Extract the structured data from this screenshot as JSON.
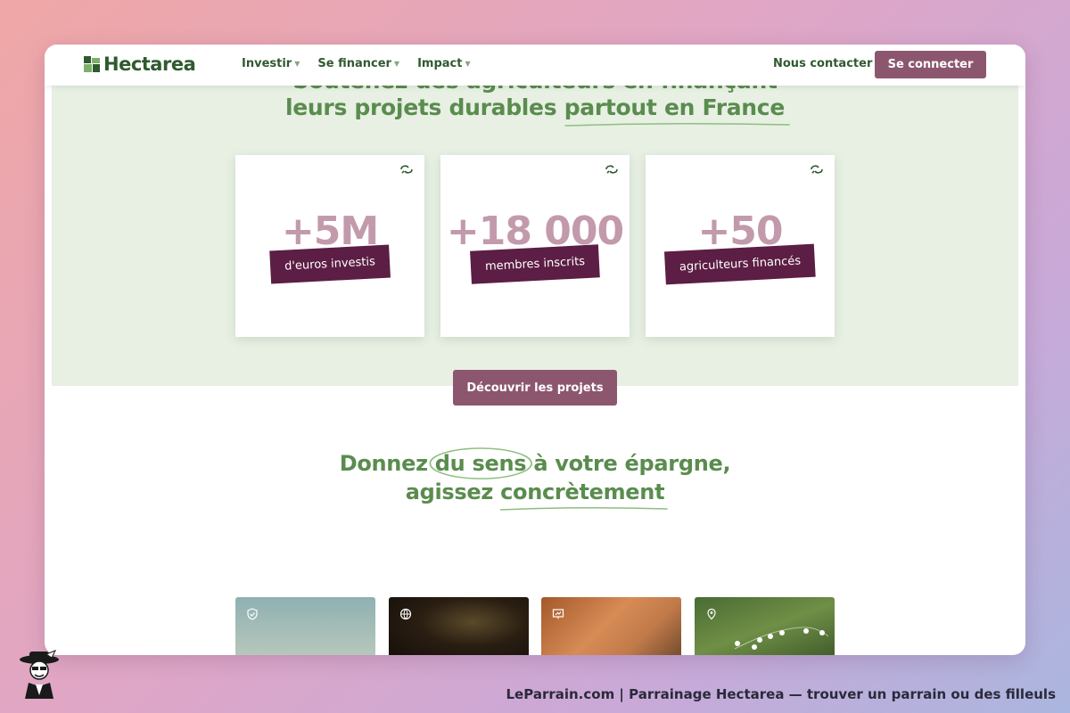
{
  "brand": {
    "name": "Hectarea"
  },
  "nav": {
    "items": [
      {
        "label": "Investir"
      },
      {
        "label": "Se financer"
      },
      {
        "label": "Impact"
      }
    ],
    "contact_label": "Nous contacter",
    "login_label": "Se connecter"
  },
  "hero": {
    "line1": "Soutenez des agriculteurs en finançant",
    "line2_prefix": "leurs projets durables ",
    "line2_highlight": "partout en France"
  },
  "stats": [
    {
      "value": "+5M",
      "label": "d'euros investis",
      "icon": "sprout-icon"
    },
    {
      "value": "+18 000",
      "label": "membres inscrits",
      "icon": "sprout-icon"
    },
    {
      "value": "+50",
      "label": "agriculteurs financés",
      "icon": "sprout-icon"
    }
  ],
  "cta": {
    "discover_label": "Découvrir les projets"
  },
  "section": {
    "line1_prefix": "Donnez ",
    "line1_circled": "du sens",
    "line1_suffix": " à votre épargne,",
    "line2_prefix": "agissez ",
    "line2_highlight": "concrètement"
  },
  "thumbnails": [
    {
      "icon": "shield-check-icon"
    },
    {
      "icon": "globe-icon"
    },
    {
      "icon": "presentation-icon"
    },
    {
      "icon": "map-pin-icon"
    }
  ],
  "footer": {
    "caption": "LeParrain.com | Parrainage Hectarea — trouver un parrain ou des filleuls"
  },
  "colors": {
    "brand_green": "#5a8c4e",
    "dark_green": "#2f5a2f",
    "mauve_button": "#8d566f",
    "tag_plum": "#5c1e44",
    "stat_pink": "#c29aac",
    "hero_bg": "#e7f0e3"
  }
}
